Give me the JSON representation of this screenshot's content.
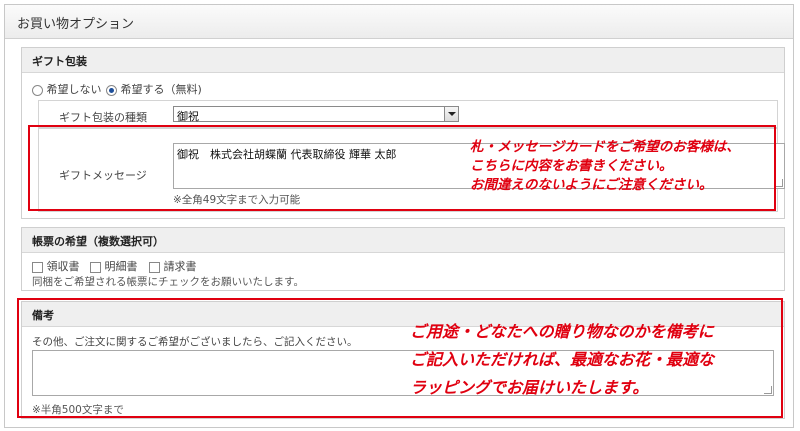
{
  "panel": {
    "title": "お買い物オプション"
  },
  "gift": {
    "title": "ギフト包装",
    "radio_options": [
      {
        "label": "希望しない",
        "selected": false
      },
      {
        "label": "希望する（無料)",
        "selected": true
      }
    ],
    "type_label": "ギフト包装の種類",
    "type_value": "御祝",
    "message_label": "ギフトメッセージ",
    "message_value": "御祝　株式会社胡蝶蘭 代表取締役 輝華 太郎",
    "message_note": "※全角49文字まで入力可能",
    "callout_lines": [
      "札・メッセージカードをご希望のお客様は、",
      "こちらに内容をお書きください。",
      "お間違えのないようにご注意ください。"
    ]
  },
  "forms": {
    "title": "帳票の希望（複数選択可）",
    "options": [
      {
        "label": "領収書",
        "checked": false
      },
      {
        "label": "明細書",
        "checked": false
      },
      {
        "label": "請求書",
        "checked": false
      }
    ],
    "note": "同梱をご希望される帳票にチェックをお願いいたします。"
  },
  "remarks": {
    "title": "備考",
    "description": "その他、ご注文に関するご希望がございましたら、ご記入ください。",
    "value": "",
    "note": "※半角500文字まで",
    "callout_lines": [
      "ご用途・どなたへの贈り物なのかを備考に",
      "ご記入いただければ、最適なお花・最適な",
      "ラッピングでお届けいたします。"
    ]
  },
  "colors": {
    "accent_red": "#e00010",
    "radio_fill": "#1e4f9a"
  }
}
